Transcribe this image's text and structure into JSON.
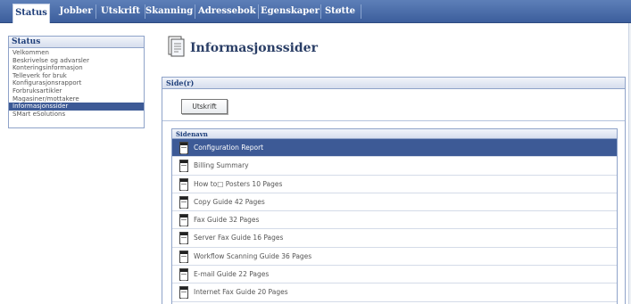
{
  "nav": {
    "tabs": [
      {
        "label": "Status",
        "active": true
      },
      {
        "label": "Jobber",
        "active": false
      },
      {
        "label": "Utskrift",
        "active": false
      },
      {
        "label": "Skanning",
        "active": false
      },
      {
        "label": "Adressebok",
        "active": false
      },
      {
        "label": "Egenskaper",
        "active": false
      },
      {
        "label": "Støtte",
        "active": false
      }
    ]
  },
  "sidebar": {
    "title": "Status",
    "items": [
      {
        "label": "Velkommen",
        "selected": false
      },
      {
        "label": "Beskrivelse og advarsler",
        "selected": false
      },
      {
        "label": "Konteringsinformasjon",
        "selected": false
      },
      {
        "label": "Telleverk for bruk",
        "selected": false
      },
      {
        "label": "Konfigurasjonsrapport",
        "selected": false
      },
      {
        "label": "Forbruksartikler",
        "selected": false
      },
      {
        "label": "Magasiner/mottakere",
        "selected": false
      },
      {
        "label": "Informasjonssider",
        "selected": true
      },
      {
        "label": "SMart eSolutions",
        "selected": false
      }
    ]
  },
  "main": {
    "title": "Informasjonssider",
    "section_header": "Side(r)",
    "print_button": "Utskrift",
    "table": {
      "column_header": "Sidenavn",
      "rows": [
        {
          "label": "Configuration Report",
          "selected": true
        },
        {
          "label": "Billing Summary",
          "selected": false
        },
        {
          "label": "How to□ Posters 10 Pages",
          "selected": false
        },
        {
          "label": "Copy Guide 42 Pages",
          "selected": false
        },
        {
          "label": "Fax Guide 32 Pages",
          "selected": false
        },
        {
          "label": "Server Fax Guide 16 Pages",
          "selected": false
        },
        {
          "label": "Workflow Scanning Guide 36 Pages",
          "selected": false
        },
        {
          "label": "E-mail Guide 22 Pages",
          "selected": false
        },
        {
          "label": "Internet Fax Guide 20 Pages",
          "selected": false
        }
      ]
    }
  },
  "colors": {
    "nav_bg": "#3c5e9c",
    "selected_bg": "#3d5a96",
    "header_text": "#1f3f7a"
  }
}
